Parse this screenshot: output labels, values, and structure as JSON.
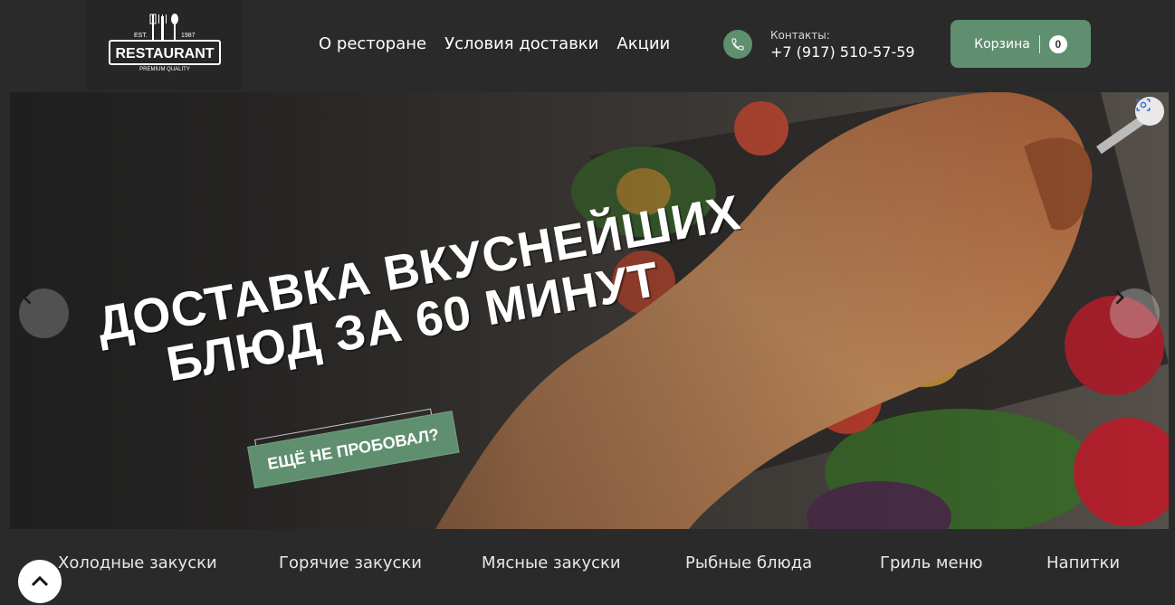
{
  "header": {
    "logo": {
      "est": "EST.",
      "year": "1987",
      "name": "RESTAURANT",
      "tagline": "PREMIUM QUALITY"
    },
    "nav": [
      "О ресторане",
      "Условия доставки",
      "Акции"
    ],
    "contacts": {
      "label": "Контакты:",
      "phone": "+7 (917) 510-57-59"
    },
    "cart": {
      "label": "Корзина",
      "count": "0"
    }
  },
  "banner": {
    "headline_line1": "ДОСТАВКА ВКУСНЕЙШИХ",
    "headline_line2": "БЛЮД ЗА 60 МИНУТ",
    "promo": "ЕЩЁ НЕ ПРОБОВАЛ?"
  },
  "categories": [
    "Холодные закуски",
    "Горячие закуски",
    "Мясные закуски",
    "Рыбные блюда",
    "Гриль меню",
    "Напитки"
  ],
  "colors": {
    "accent": "#5f8f6f",
    "background": "#2a2a2a"
  },
  "icons": {
    "phone": "phone-icon",
    "prev": "chevron-left-icon",
    "next": "chevron-right-icon",
    "scan": "visual-search-icon",
    "up": "chevron-up-icon"
  }
}
